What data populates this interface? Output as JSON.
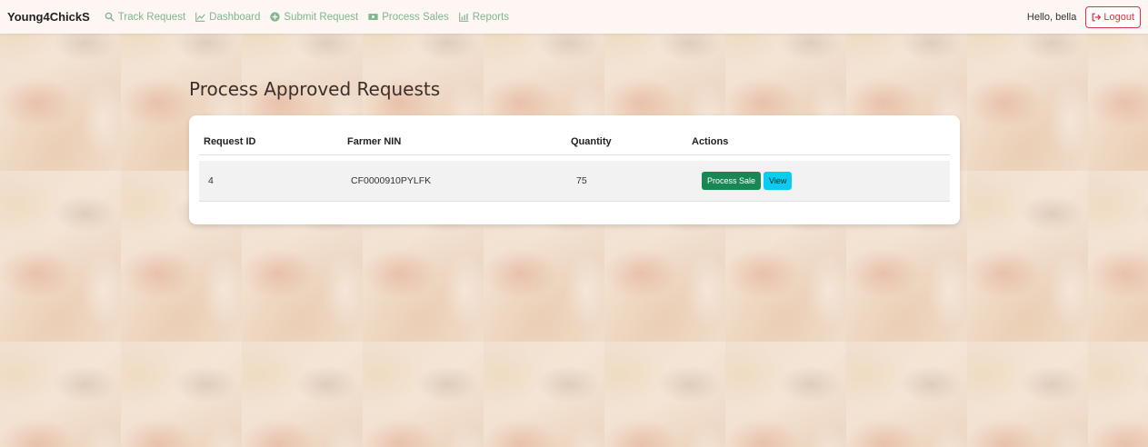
{
  "navbar": {
    "brand": "Young4ChickS",
    "links": [
      {
        "label": "Track Request",
        "icon": "search-icon"
      },
      {
        "label": "Dashboard",
        "icon": "chart-line-icon"
      },
      {
        "label": "Submit Request",
        "icon": "plus-circle-icon"
      },
      {
        "label": "Process Sales",
        "icon": "cash-icon"
      },
      {
        "label": "Reports",
        "icon": "bar-chart-icon"
      }
    ],
    "greeting": "Hello, bella",
    "logout_label": "Logout"
  },
  "page": {
    "title": "Process Approved Requests"
  },
  "table": {
    "headers": [
      "Request ID",
      "Farmer NIN",
      "Quantity",
      "Actions"
    ],
    "rows": [
      {
        "request_id": "4",
        "farmer_nin": "CF0000910PYLFK",
        "quantity": "75",
        "actions": {
          "process": "Process Sale",
          "view": "View"
        }
      }
    ]
  },
  "colors": {
    "nav_link": "#7fb88f",
    "logout": "#dc3545",
    "process_button": "#198754",
    "view_button": "#0dcaf0"
  }
}
